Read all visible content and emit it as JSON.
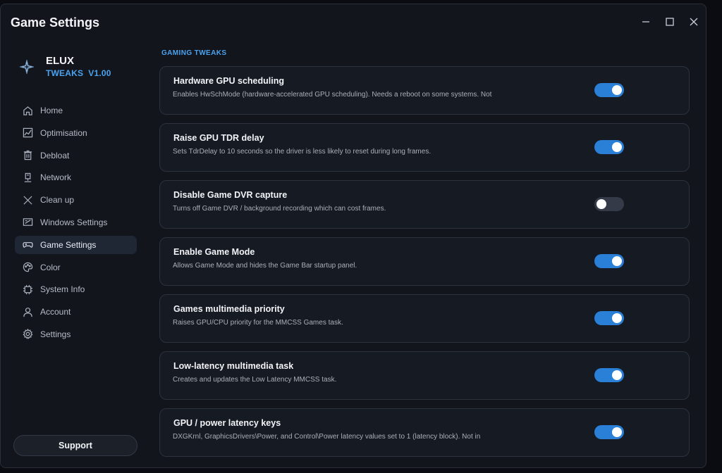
{
  "window": {
    "title": "Game Settings",
    "controls": [
      "minimize-icon",
      "maximize-icon",
      "close-icon"
    ]
  },
  "brand": {
    "name": "ELUX",
    "subtitle": "TWEAKS  V1.00",
    "icon": "star-sparkle-icon"
  },
  "sidebar": {
    "items": [
      {
        "label": "Home",
        "icon": "home-icon"
      },
      {
        "label": "Optimisation",
        "icon": "chart-icon"
      },
      {
        "label": "Debloat",
        "icon": "trash-icon"
      },
      {
        "label": "Network",
        "icon": "network-icon"
      },
      {
        "label": "Clean up",
        "icon": "broom-icon"
      },
      {
        "label": "Windows Settings",
        "icon": "window-settings-icon"
      },
      {
        "label": "Game Settings",
        "icon": "gamepad-icon",
        "active": true
      },
      {
        "label": "Color",
        "icon": "palette-icon"
      },
      {
        "label": "System Info",
        "icon": "chip-icon"
      },
      {
        "label": "Account",
        "icon": "user-icon"
      },
      {
        "label": "Settings",
        "icon": "gear-icon"
      }
    ],
    "support_label": "Support"
  },
  "main": {
    "section_title": "GAMING TWEAKS",
    "tweaks": [
      {
        "title": "Hardware GPU scheduling",
        "desc": "Enables HwSchMode (hardware-accelerated GPU scheduling). Needs a reboot on some systems. Not",
        "enabled": true
      },
      {
        "title": "Raise GPU TDR delay",
        "desc": "Sets TdrDelay to 10 seconds so the driver is less likely to reset during long frames.",
        "enabled": true
      },
      {
        "title": "Disable Game DVR capture",
        "desc": "Turns off Game DVR / background recording which can cost frames.",
        "enabled": false
      },
      {
        "title": "Enable Game Mode",
        "desc": "Allows Game Mode and hides the Game Bar startup panel.",
        "enabled": true
      },
      {
        "title": "Games multimedia priority",
        "desc": "Raises GPU/CPU priority for the MMCSS Games task.",
        "enabled": true
      },
      {
        "title": "Low-latency multimedia task",
        "desc": "Creates and updates the Low Latency MMCSS task.",
        "enabled": true
      },
      {
        "title": "GPU / power latency keys",
        "desc": "DXGKrnl, GraphicsDrivers\\Power, and Control\\Power latency values set to 1 (latency block). Not in",
        "enabled": true
      }
    ]
  },
  "colors": {
    "accent": "#4aa3f0",
    "toggle_on": "#2a7fd6",
    "toggle_off": "#343a47",
    "background": "#12151c",
    "card": "#161a22"
  }
}
